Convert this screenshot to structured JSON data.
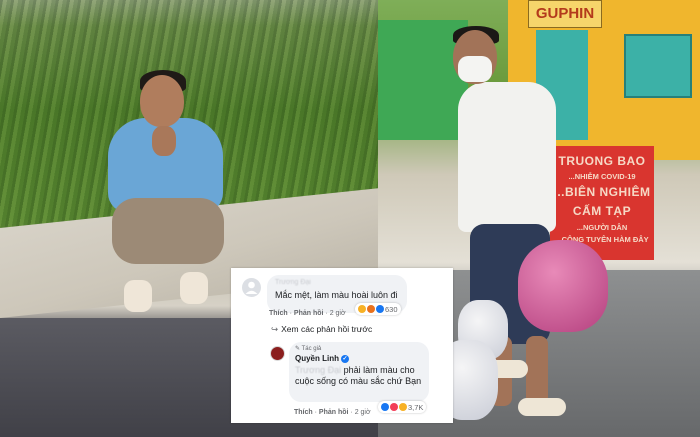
{
  "right_photo": {
    "shop_sign": "GUPHIN",
    "banner": {
      "line1": "TRUONG BAO",
      "line2": "...NHIỄM COVID-19",
      "line3": "...BIÊN NGHIÊM CẤM TẠP",
      "line4": "...NGƯỜI DÂN",
      "line5": "...CÔNG TUYÊN HÀM ĐÂY"
    }
  },
  "comment_overlay": {
    "comment": {
      "author": "Trương Đại",
      "text": "Mắc mệt, làm màu hoài luôn đi",
      "reaction_count": "630",
      "like_label": "Thích",
      "reply_label": "Phản hồi",
      "time": "2 giờ"
    },
    "see_replies_label": "Xem các phản hồi trước",
    "reply": {
      "author_tag": "Tác giả",
      "author": "Quyền Linh",
      "mention": "Trương Đại",
      "text": "phải làm màu cho cuộc sống có màu sắc chứ Bạn",
      "reaction_count": "3,7K",
      "like_label": "Thích",
      "reply_label": "Phản hồi",
      "time": "2 giờ"
    }
  },
  "colors": {
    "facebook_blue": "#1877f2",
    "bubble_gray": "#f0f2f5",
    "banner_red": "#d9352f"
  }
}
